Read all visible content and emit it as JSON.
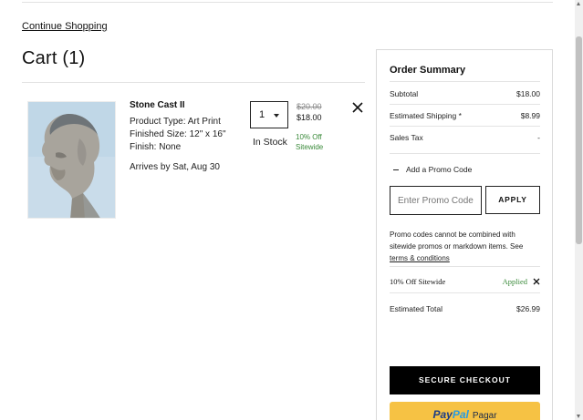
{
  "nav": {
    "continue_label": "Continue Shopping"
  },
  "cart": {
    "title": "Cart (1)",
    "item": {
      "name": "Stone Cast II",
      "product_type": "Product Type: Art Print",
      "finished_size": "Finished Size: 12\" x 16\"",
      "finish": "Finish: None",
      "arrives": "Arrives by Sat, Aug 30",
      "quantity": "1",
      "stock": "In Stock",
      "price_original": "$20.00",
      "price_current": "$18.00",
      "promo_note_line1": "10% Off",
      "promo_note_line2": "Sitewide",
      "remove_icon": "close-icon"
    }
  },
  "summary": {
    "title": "Order Summary",
    "subtotal_label": "Subtotal",
    "subtotal_value": "$18.00",
    "shipping_label": "Estimated Shipping *",
    "shipping_value": "$8.99",
    "tax_label": "Sales Tax",
    "tax_value": "-",
    "add_promo_label": "Add a Promo Code",
    "promo_placeholder": "Enter Promo Code",
    "apply_label": "APPLY",
    "promo_terms_text": "Promo codes cannot be combined with sitewide promos or markdown items. See",
    "promo_terms_link": "terms & conditions",
    "applied_promo_name": "10% Off Sitewide",
    "applied_status": "Applied",
    "total_label": "Estimated Total",
    "total_value": "$26.99",
    "checkout_label": "SECURE CHECKOUT",
    "paypal_brand_1": "Pay",
    "paypal_brand_2": "Pal",
    "paypal_suffix": "Pagar"
  },
  "colors": {
    "promo_green": "#3a8a3a",
    "checkout_bg": "#000000",
    "paypal_bg": "#f6c244",
    "paypal_dark": "#1b3c87",
    "paypal_light": "#2a9be0"
  }
}
